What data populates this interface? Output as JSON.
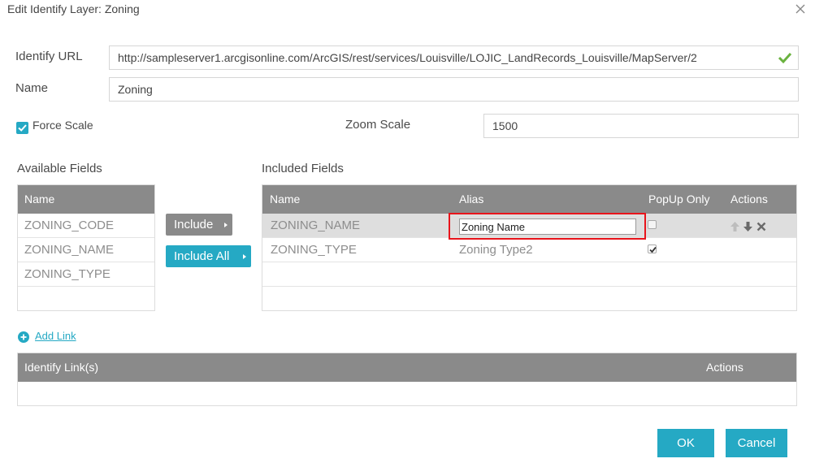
{
  "dialog": {
    "title": "Edit Identify Layer: Zoning",
    "close_icon": "close-icon"
  },
  "form": {
    "identify_url_label": "Identify URL",
    "identify_url_value": "http://sampleserver1.arcgisonline.com/ArcGIS/rest/services/Louisville/LOJIC_LandRecords_Louisville/MapServer/2",
    "url_valid_icon": "checkmark-icon",
    "name_label": "Name",
    "name_value": "Zoning",
    "force_scale_label": "Force Scale",
    "force_scale_checked": true,
    "zoom_scale_label": "Zoom Scale",
    "zoom_scale_value": "1500"
  },
  "available_fields": {
    "title": "Available Fields",
    "header": "Name",
    "items": [
      "ZONING_CODE",
      "ZONING_NAME",
      "ZONING_TYPE"
    ]
  },
  "transfer": {
    "include_label": "Include",
    "include_all_label": "Include All"
  },
  "included_fields": {
    "title": "Included Fields",
    "headers": {
      "name": "Name",
      "alias": "Alias",
      "popup_only": "PopUp Only",
      "actions": "Actions"
    },
    "rows": [
      {
        "name": "ZONING_NAME",
        "alias": "Zoning Name",
        "popup_only": false,
        "editing": true
      },
      {
        "name": "ZONING_TYPE",
        "alias": "Zoning Type2",
        "popup_only": true,
        "editing": false
      }
    ],
    "action_icons": [
      "arrow-up-icon",
      "arrow-down-icon",
      "delete-icon"
    ]
  },
  "links": {
    "add_link_label": "Add Link",
    "add_link_icon": "plus-circle-icon",
    "headers": {
      "identify_links": "Identify Link(s)",
      "actions": "Actions"
    },
    "rows": []
  },
  "footer": {
    "ok_label": "OK",
    "cancel_label": "Cancel"
  },
  "colors": {
    "accent": "#25a9c4",
    "header_gray": "#8a8a8a",
    "highlight_red": "#e8141b",
    "valid_green": "#6ab23f"
  }
}
